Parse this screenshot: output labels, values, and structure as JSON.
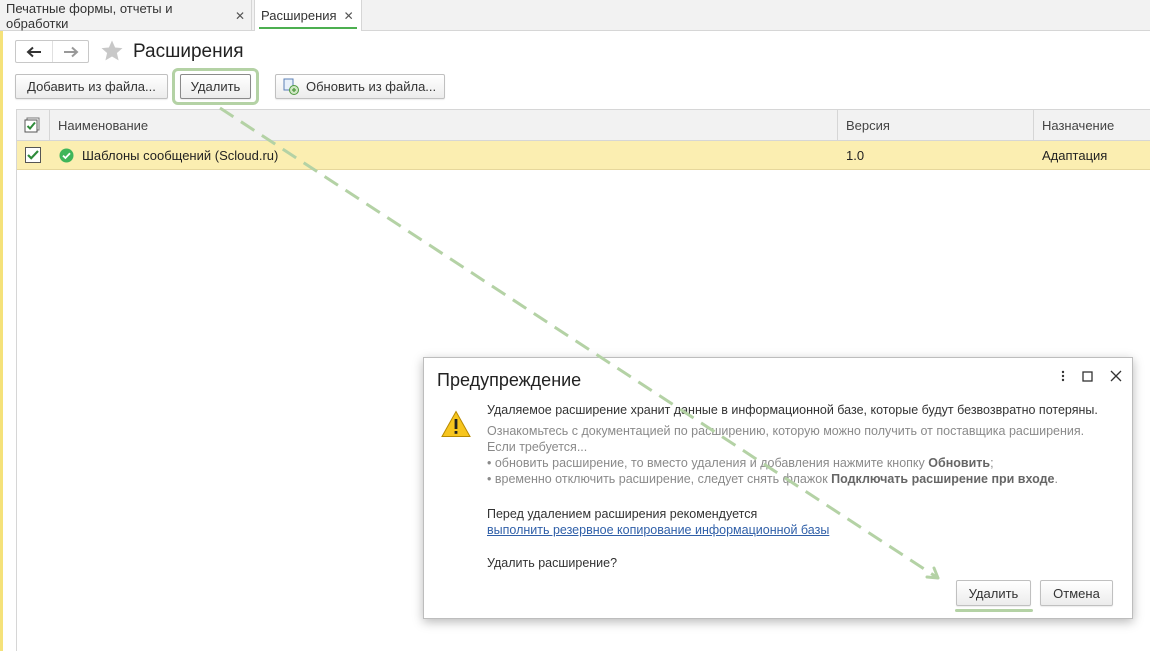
{
  "tabs": [
    {
      "label": "Печатные формы, отчеты и обработки",
      "close": "✕"
    },
    {
      "label": "Расширения",
      "close": "✕"
    }
  ],
  "header": {
    "back_icon": "arrow-left-icon",
    "forward_icon": "arrow-right-icon",
    "favorite_icon": "star-icon",
    "title": "Расширения"
  },
  "toolbar": {
    "add_label": "Добавить из файла...",
    "delete_label": "Удалить",
    "update_label": "Обновить из файла..."
  },
  "table": {
    "columns": [
      "Наименование",
      "Версия",
      "Назначение"
    ],
    "rows": [
      {
        "checked": true,
        "name": "Шаблоны сообщений (Scloud.ru)",
        "version": "1.0",
        "purpose": "Адаптация"
      }
    ]
  },
  "dialog": {
    "title": "Предупреждение",
    "main_text": "Удаляемое расширение хранит данные в информационной базе, которые будут безвозвратно потеряны.",
    "info_line1": "Ознакомьтесь с документацией по расширению, которую можно получить от поставщика расширения.",
    "info_line2": "Если требуется...",
    "info_line3_pre": "• обновить расширение, то вместо удаления и добавления нажмите кнопку ",
    "info_line3_bold": "Обновить",
    "info_line3_post": ";",
    "info_line4_pre": "• временно отключить расширение, следует снять флажок ",
    "info_line4_bold": "Подключать расширение при входе",
    "info_line4_post": ".",
    "rec_text": "Перед удалением расширения рекомендуется",
    "rec_link": "выполнить резервное копирование информационной базы",
    "question": "Удалить расширение?",
    "delete_label": "Удалить",
    "cancel_label": "Отмена"
  },
  "colors": {
    "highlight": "#b4d2a5",
    "selected_row": "#fbeeb1",
    "active_tab_underline": "#4caf50"
  }
}
